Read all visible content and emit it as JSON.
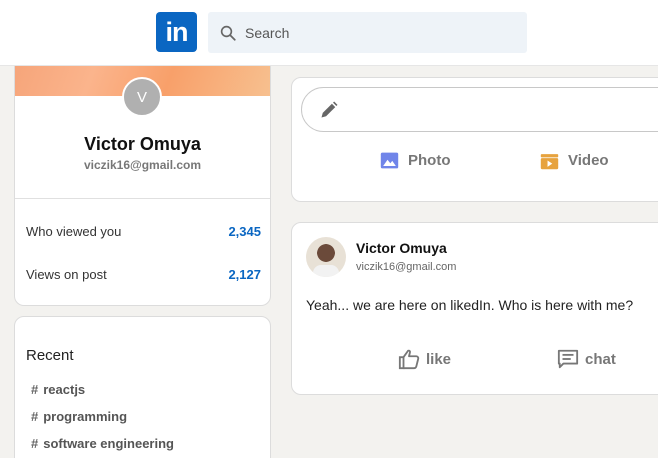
{
  "header": {
    "logo_text": "in",
    "search": {
      "placeholder": "Search"
    }
  },
  "sidebar": {
    "profile": {
      "avatar_initial": "V",
      "name": "Victor Omuya",
      "email": "viczik16@gmail.com",
      "stats": [
        {
          "label": "Who viewed you",
          "value": "2,345"
        },
        {
          "label": "Views on post",
          "value": "2,127"
        }
      ]
    },
    "recent": {
      "title": "Recent",
      "items": [
        "reactjs",
        "programming",
        "software engineering"
      ]
    }
  },
  "composer": {
    "actions": [
      {
        "label": "Photo",
        "icon": "photo-icon",
        "color": "#7085e9"
      },
      {
        "label": "Video",
        "icon": "video-icon",
        "color": "#e7a33e"
      }
    ]
  },
  "post": {
    "author_name": "Victor Omuya",
    "author_email": "viczik16@gmail.com",
    "text": "Yeah... we are here on likedIn. Who is here with me?",
    "reactions": [
      {
        "label": "like",
        "icon": "thumbs-up-icon"
      },
      {
        "label": "chat",
        "icon": "chat-icon"
      }
    ]
  },
  "colors": {
    "brand": "#0a66c2",
    "background": "#f3f2ef"
  }
}
